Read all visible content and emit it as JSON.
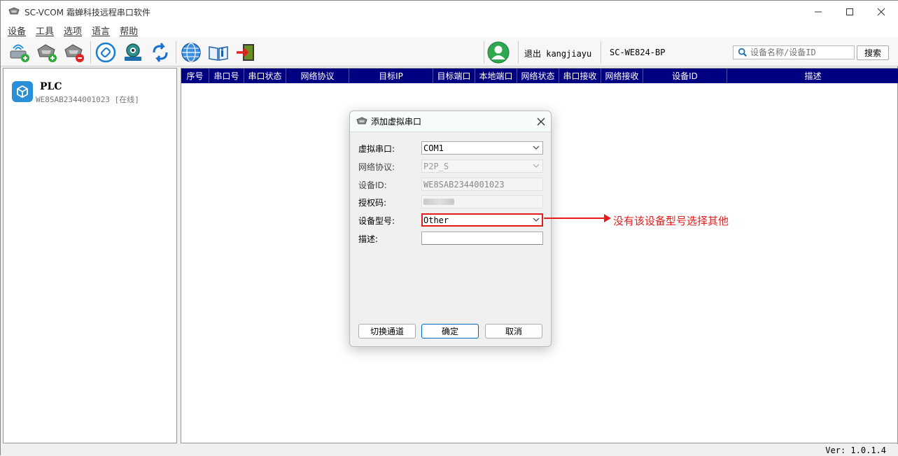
{
  "window": {
    "title": "SC-VCOM 霜蝉科技远程串口软件"
  },
  "menu": [
    "设备",
    "工具",
    "选项",
    "语言",
    "帮助"
  ],
  "toolbar": {
    "logout_text": "退出 kangjiayu",
    "device_model": "SC-WE824-BP",
    "search_placeholder": "设备名称/设备ID",
    "search_button": "搜索"
  },
  "device_list": [
    {
      "name": "PLC",
      "id_status": "WE8SAB2344001023 [在线]"
    }
  ],
  "grid": {
    "columns": [
      "序号",
      "串口号",
      "串口状态",
      "网络协议",
      "目标IP",
      "目标端口",
      "本地端口",
      "网络状态",
      "串口接收",
      "网络接收",
      "设备ID",
      "描述"
    ]
  },
  "status_bar": {
    "version": "Ver: 1.0.1.4"
  },
  "dialog": {
    "title": "添加虚拟串口",
    "fields": {
      "virtual_port_label": "虚拟串口:",
      "virtual_port_value": "COM1",
      "protocol_label": "网络协议:",
      "protocol_value": "P2P_S",
      "device_id_label": "设备ID:",
      "device_id_value": "WE8SAB2344001023",
      "auth_code_label": "授权码:",
      "device_type_label": "设备型号:",
      "device_type_value": "Other",
      "description_label": "描述:",
      "description_value": ""
    },
    "buttons": {
      "switch_channel": "切换通道",
      "ok": "确定",
      "cancel": "取消"
    }
  },
  "annotation": {
    "text": "没有该设备型号选择其他",
    "color": "#e31c1c"
  },
  "colors": {
    "grid_header": "#000080",
    "accent": "#0067c0",
    "device_icon": "#2a8fd6"
  }
}
